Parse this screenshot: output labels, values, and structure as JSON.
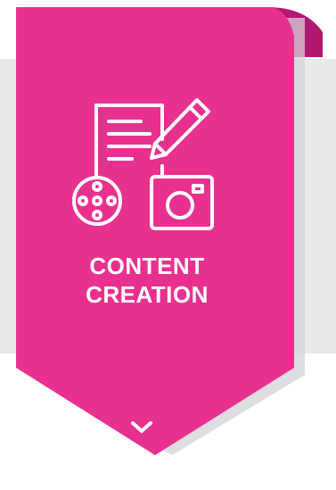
{
  "card": {
    "title_line1": "CONTENT",
    "title_line2": "CREATION"
  },
  "icons": {
    "main": "content-creation-icon",
    "document": "document-icon",
    "pencil": "pencil-icon",
    "film_reel": "film-reel-icon",
    "camera": "camera-icon",
    "expand": "chevron-down-icon"
  },
  "colors": {
    "primary_pink": "#E8318F",
    "ribbon_fold_dark": "#B01872",
    "backdrop_gray": "#E9E9EC",
    "shadow_gray": "#D3D3D8",
    "text": "#FFFFFF"
  }
}
